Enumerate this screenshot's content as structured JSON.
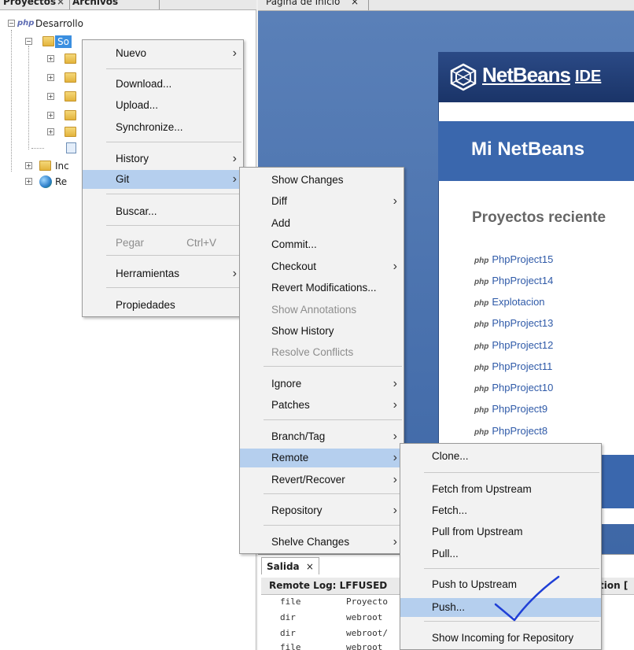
{
  "left_panel": {
    "tabs": [
      "Proyectos",
      "Archivos"
    ],
    "tab_close": "×",
    "tree": {
      "root_label": "Desarrollo",
      "selected_label": "So",
      "children_labels": [
        "Inc",
        "Re"
      ]
    }
  },
  "editor": {
    "tab_label": "Página de Inicio",
    "tab_close": "×",
    "brand": {
      "name": "NetBeans",
      "suffix": "IDE"
    },
    "heading": "Mi NetBeans",
    "recent_title": "Proyectos reciente",
    "projects": [
      "PhpProject15",
      "PhpProject14",
      "Explotacion",
      "PhpProject13",
      "PhpProject12",
      "PhpProject11",
      "PhpProject10",
      "PhpProject9",
      "PhpProject8"
    ],
    "project_badge": "php"
  },
  "output": {
    "tab_label": "Salida",
    "tab_close": "×",
    "sub_tab_label": "Remote Log: LFFUSED",
    "sub_tab_right": "tion [",
    "lines": [
      {
        "type": "file",
        "path": "Proyecto"
      },
      {
        "type": "dir",
        "path": "webroot"
      },
      {
        "type": "dir",
        "path": "webroot/"
      },
      {
        "type": "file",
        "path": "webroot"
      }
    ]
  },
  "context_menu": {
    "items": [
      {
        "label": "Nuevo",
        "submenu": true
      },
      {
        "label": "Download..."
      },
      {
        "label": "Upload..."
      },
      {
        "label": "Synchronize..."
      },
      {
        "label": "History",
        "submenu": true
      },
      {
        "label": "Git",
        "submenu": true,
        "selected": true
      },
      {
        "label": "Buscar..."
      },
      {
        "label": "Pegar",
        "shortcut": "Ctrl+V",
        "disabled": true
      },
      {
        "label": "Herramientas",
        "submenu": true
      },
      {
        "label": "Propiedades"
      }
    ]
  },
  "git_menu": {
    "items": [
      {
        "label": "Show Changes"
      },
      {
        "label": "Diff",
        "submenu": true
      },
      {
        "label": "Add"
      },
      {
        "label": "Commit..."
      },
      {
        "label": "Checkout",
        "submenu": true
      },
      {
        "label": "Revert Modifications..."
      },
      {
        "label": "Show Annotations",
        "disabled": true
      },
      {
        "label": "Show History"
      },
      {
        "label": "Resolve Conflicts",
        "disabled": true
      },
      {
        "label": "Ignore",
        "submenu": true
      },
      {
        "label": "Patches",
        "submenu": true
      },
      {
        "label": "Branch/Tag",
        "submenu": true
      },
      {
        "label": "Remote",
        "submenu": true,
        "selected": true
      },
      {
        "label": "Revert/Recover",
        "submenu": true
      },
      {
        "label": "Repository",
        "submenu": true
      },
      {
        "label": "Shelve Changes",
        "submenu": true
      }
    ]
  },
  "remote_menu": {
    "items": [
      {
        "label": "Clone..."
      },
      {
        "label": "Fetch from Upstream"
      },
      {
        "label": "Fetch..."
      },
      {
        "label": "Pull from Upstream"
      },
      {
        "label": "Pull..."
      },
      {
        "label": "Push to Upstream"
      },
      {
        "label": "Push...",
        "selected": true
      },
      {
        "label": "Show Incoming for Repository"
      }
    ]
  },
  "colors": {
    "menu_bg": "#f2f2f2",
    "selection": "#b5cfee",
    "editor_blue": "#3e67a6",
    "annotation": "#1f3fd6"
  }
}
